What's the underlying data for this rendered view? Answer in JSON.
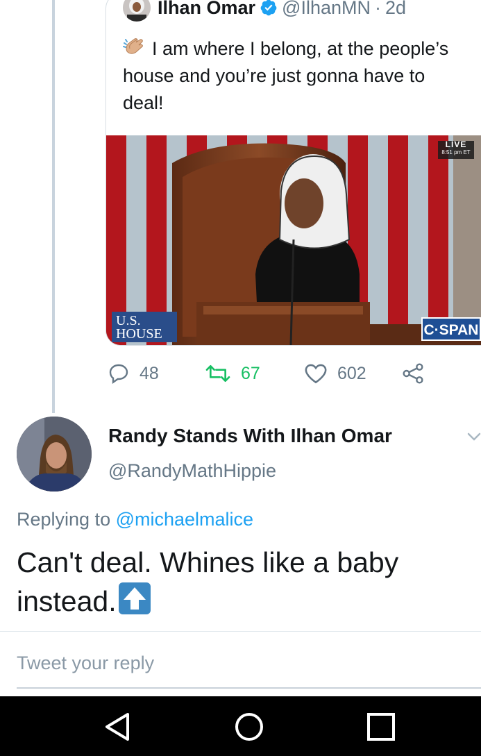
{
  "quoted_tweet": {
    "author_name": "Ilhan Omar",
    "author_handle": "@IlhanMN",
    "separator": "·",
    "time": "2d",
    "text": "I am where I belong, at the people’s house and you’re just gonna have to deal!",
    "media": {
      "live_label": "LIVE",
      "live_time": "8:51 pm ET",
      "network_logo": "C·SPAN",
      "house_line1": "U.S.",
      "house_line2": "HOUSE"
    },
    "actions": {
      "replies": "48",
      "retweets": "67",
      "likes": "602"
    }
  },
  "reply_tweet": {
    "author_name": "Randy Stands With Ilhan Omar",
    "author_handle": "@RandyMathHippie",
    "replying_prefix": "Replying to",
    "replying_to": "@michaelmalice",
    "text": "Can't deal. Whines like a baby instead."
  },
  "composer": {
    "placeholder": "Tweet your reply"
  },
  "colors": {
    "accent": "#1da1f2",
    "retweet_green": "#17bf63",
    "muted": "#657786"
  },
  "icons": [
    "verified-badge-icon",
    "clapping-hands-emoji",
    "reply-icon",
    "retweet-icon",
    "like-icon",
    "share-icon",
    "chevron-down-icon",
    "up-arrow-emoji",
    "back-icon",
    "home-icon",
    "recents-icon"
  ]
}
